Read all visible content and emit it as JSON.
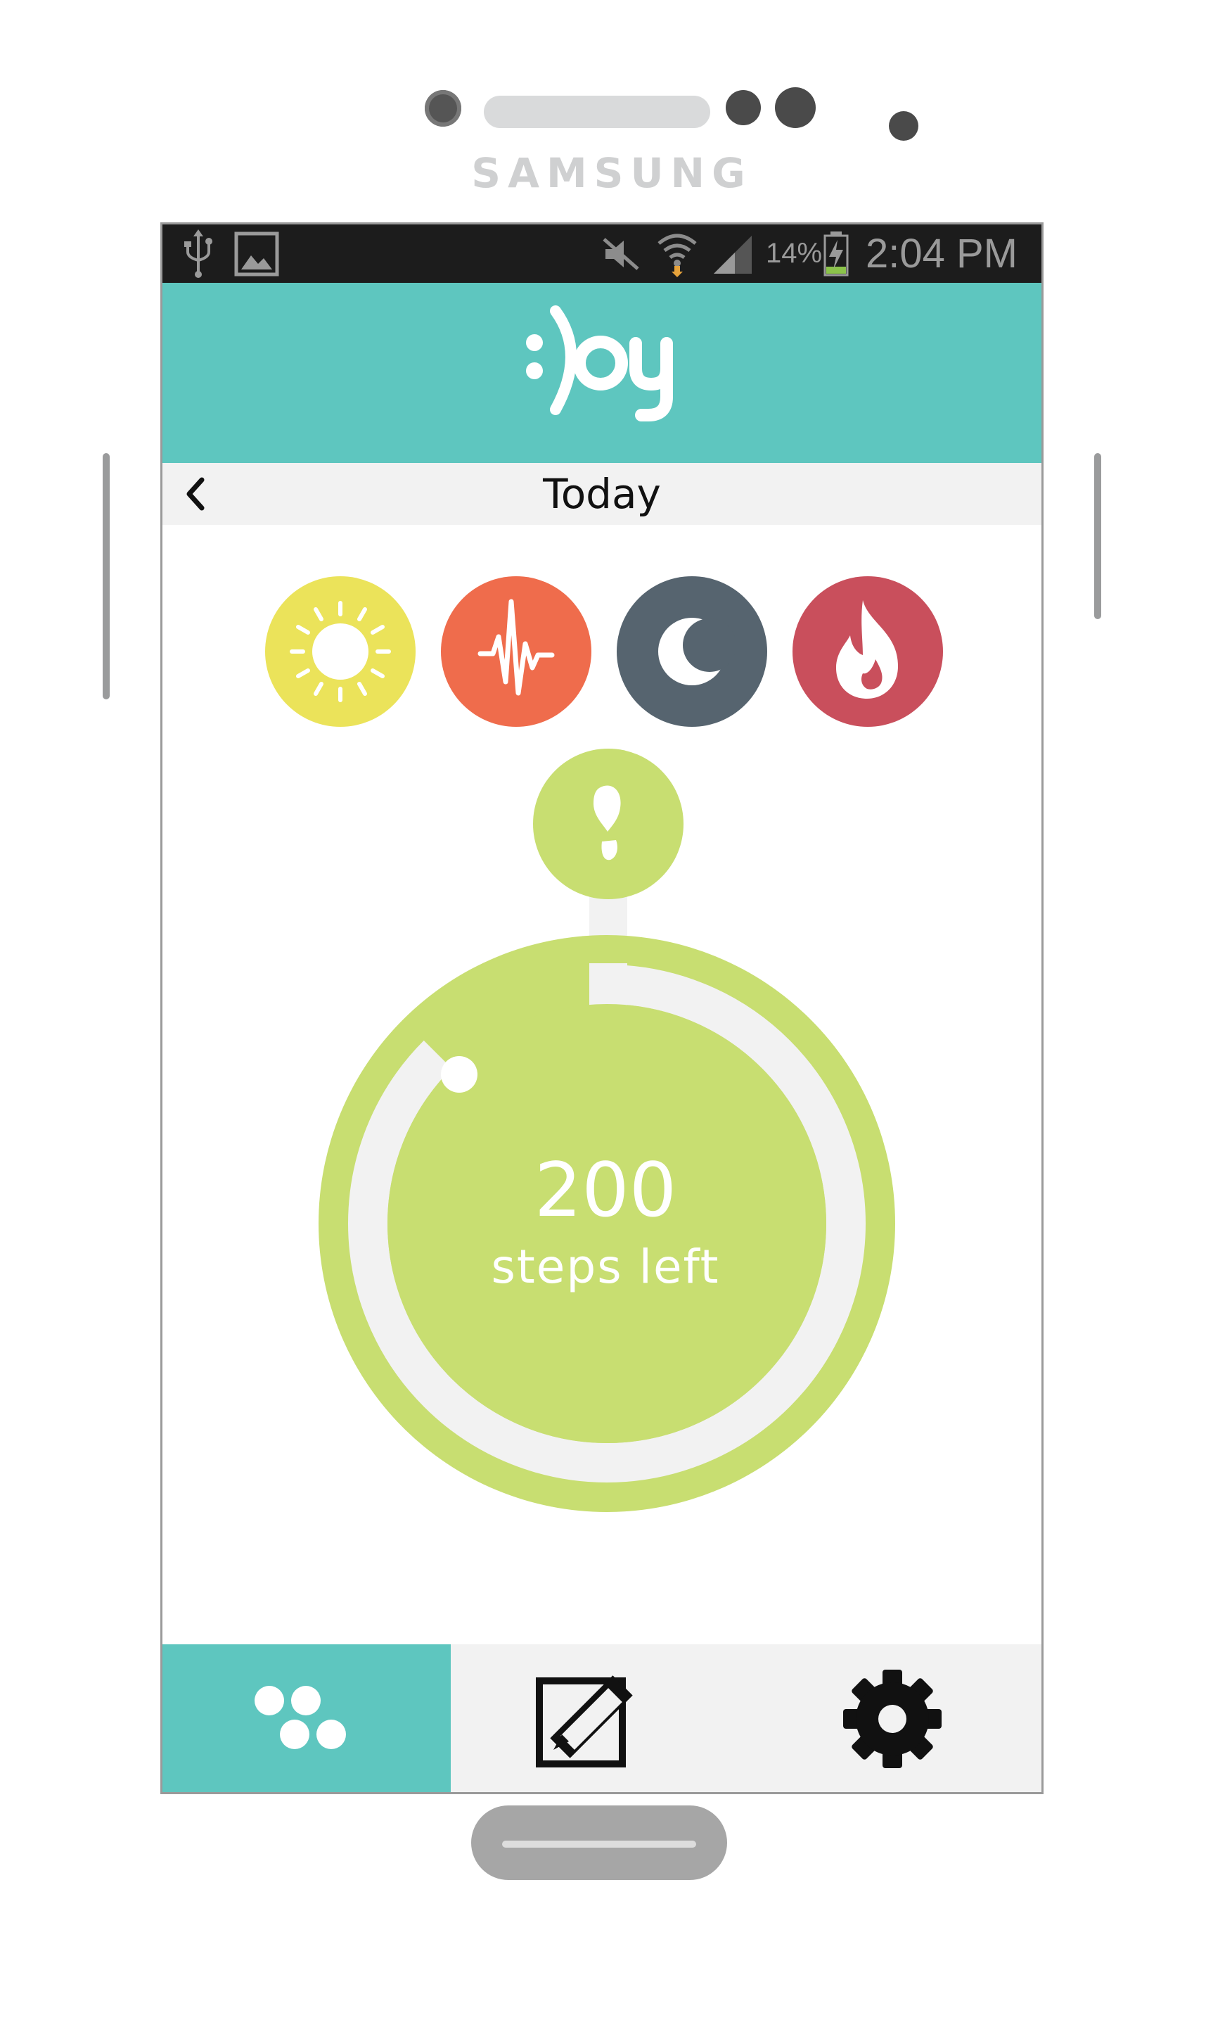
{
  "device": {
    "brand": "SAMSUNG"
  },
  "status_bar": {
    "battery": "14%",
    "time": "2:04 PM",
    "icons": [
      "usb-icon",
      "image-icon",
      "mute-icon",
      "wifi-icon",
      "signal-icon",
      "battery-charging-icon"
    ]
  },
  "app": {
    "logo": ":)oy",
    "accent": "#5ec6bf"
  },
  "header": {
    "title": "Today"
  },
  "categories": [
    {
      "name": "sun-icon",
      "color": "#ebe35a"
    },
    {
      "name": "heartbeat-icon",
      "color": "#ef6c4c"
    },
    {
      "name": "moon-icon",
      "color": "#56646f"
    },
    {
      "name": "flame-icon",
      "color": "#c94f5c"
    }
  ],
  "steps": {
    "value": "200",
    "caption": "steps left",
    "badge_icon": "footprint-icon",
    "color": "#c8de71"
  },
  "bottom_nav": [
    {
      "name": "dashboard-icon",
      "active": true
    },
    {
      "name": "edit-icon",
      "active": false
    },
    {
      "name": "settings-icon",
      "active": false
    }
  ]
}
